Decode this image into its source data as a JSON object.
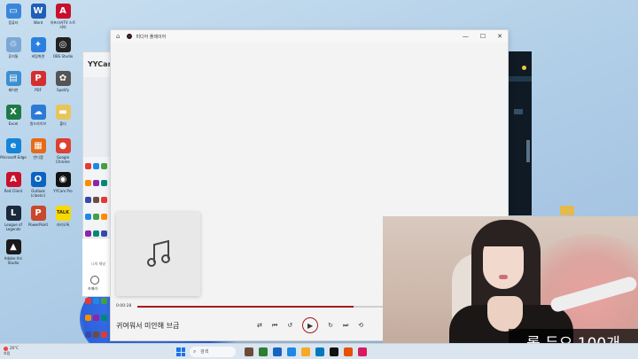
{
  "desktop": {
    "icons": [
      {
        "label": "컴퓨터",
        "color": "#3b86d8",
        "glyph": "▭"
      },
      {
        "label": "Word",
        "color": "#1f5fb8",
        "glyph": "W"
      },
      {
        "label": "아프리카TV 스트리머",
        "color": "#c8102e",
        "glyph": "A"
      },
      {
        "label": "휴지통",
        "color": "#7aa7d6",
        "glyph": "♲"
      },
      {
        "label": "바탕화면",
        "color": "#2a7fe0",
        "glyph": "✦"
      },
      {
        "label": "OBS Studio",
        "color": "#222222",
        "glyph": "◎"
      },
      {
        "label": "제어판",
        "color": "#3c8fd0",
        "glyph": "▤"
      },
      {
        "label": "PDF",
        "color": "#d32f2f",
        "glyph": "P"
      },
      {
        "label": "Spotify",
        "color": "#555555",
        "glyph": "✿"
      },
      {
        "label": "Excel",
        "color": "#1e7a45",
        "glyph": "X"
      },
      {
        "label": "원드라이브",
        "color": "#2b7bd6",
        "glyph": "☁"
      },
      {
        "label": "폴더",
        "color": "#e8c55a",
        "glyph": "▬"
      },
      {
        "label": "Microsoft Edge",
        "color": "#1584d8",
        "glyph": "e"
      },
      {
        "label": "반디캠",
        "color": "#e36b1a",
        "glyph": "▦"
      },
      {
        "label": "Google Chrome",
        "color": "#de4032",
        "glyph": "●"
      },
      {
        "label": "Red Client",
        "color": "#c8102e",
        "glyph": "A"
      },
      {
        "label": "Outlook (classic)",
        "color": "#0b63c1",
        "glyph": "O"
      },
      {
        "label": "YYCam Pro",
        "color": "#111111",
        "glyph": "◉"
      },
      {
        "label": "League of Legends",
        "color": "#1a2a3a",
        "glyph": "L"
      },
      {
        "label": "PowerPoint",
        "color": "#c9472a",
        "glyph": "P"
      },
      {
        "label": "카카오톡",
        "color": "#f7d900",
        "glyph": "TALK"
      },
      {
        "label": "Adobe Arc Studio",
        "color": "#1a1a1a",
        "glyph": "▲"
      }
    ]
  },
  "yycam": {
    "title": "YYCam",
    "bottom_tab": "나의 채널",
    "camera_label": "카메라"
  },
  "player": {
    "title": "미디어 플레이어",
    "current_time": "0:00:28",
    "progress_fraction": 0.58,
    "song_title": "귀여워서 미안해 브금",
    "window_controls": {
      "minimize": "—",
      "maximize": "☐",
      "close": "✕"
    },
    "controls": {
      "shuffle": "⇄",
      "previous": "⏮",
      "rewind": "↺",
      "play": "▶",
      "forward": "↻",
      "next": "⏭",
      "repeat": "⟲"
    }
  },
  "webcam": {
    "caption": "롤 듀오 100개"
  },
  "taskbar": {
    "weather_temp": "26°C",
    "weather_desc": "흐림",
    "search_label": "검색",
    "apps": [
      "#6b4c3b",
      "#2e7d32",
      "#1565c0",
      "#1e88e5",
      "#f9a825",
      "#0277bd",
      "#111111",
      "#e65100",
      "#d81b60"
    ]
  }
}
